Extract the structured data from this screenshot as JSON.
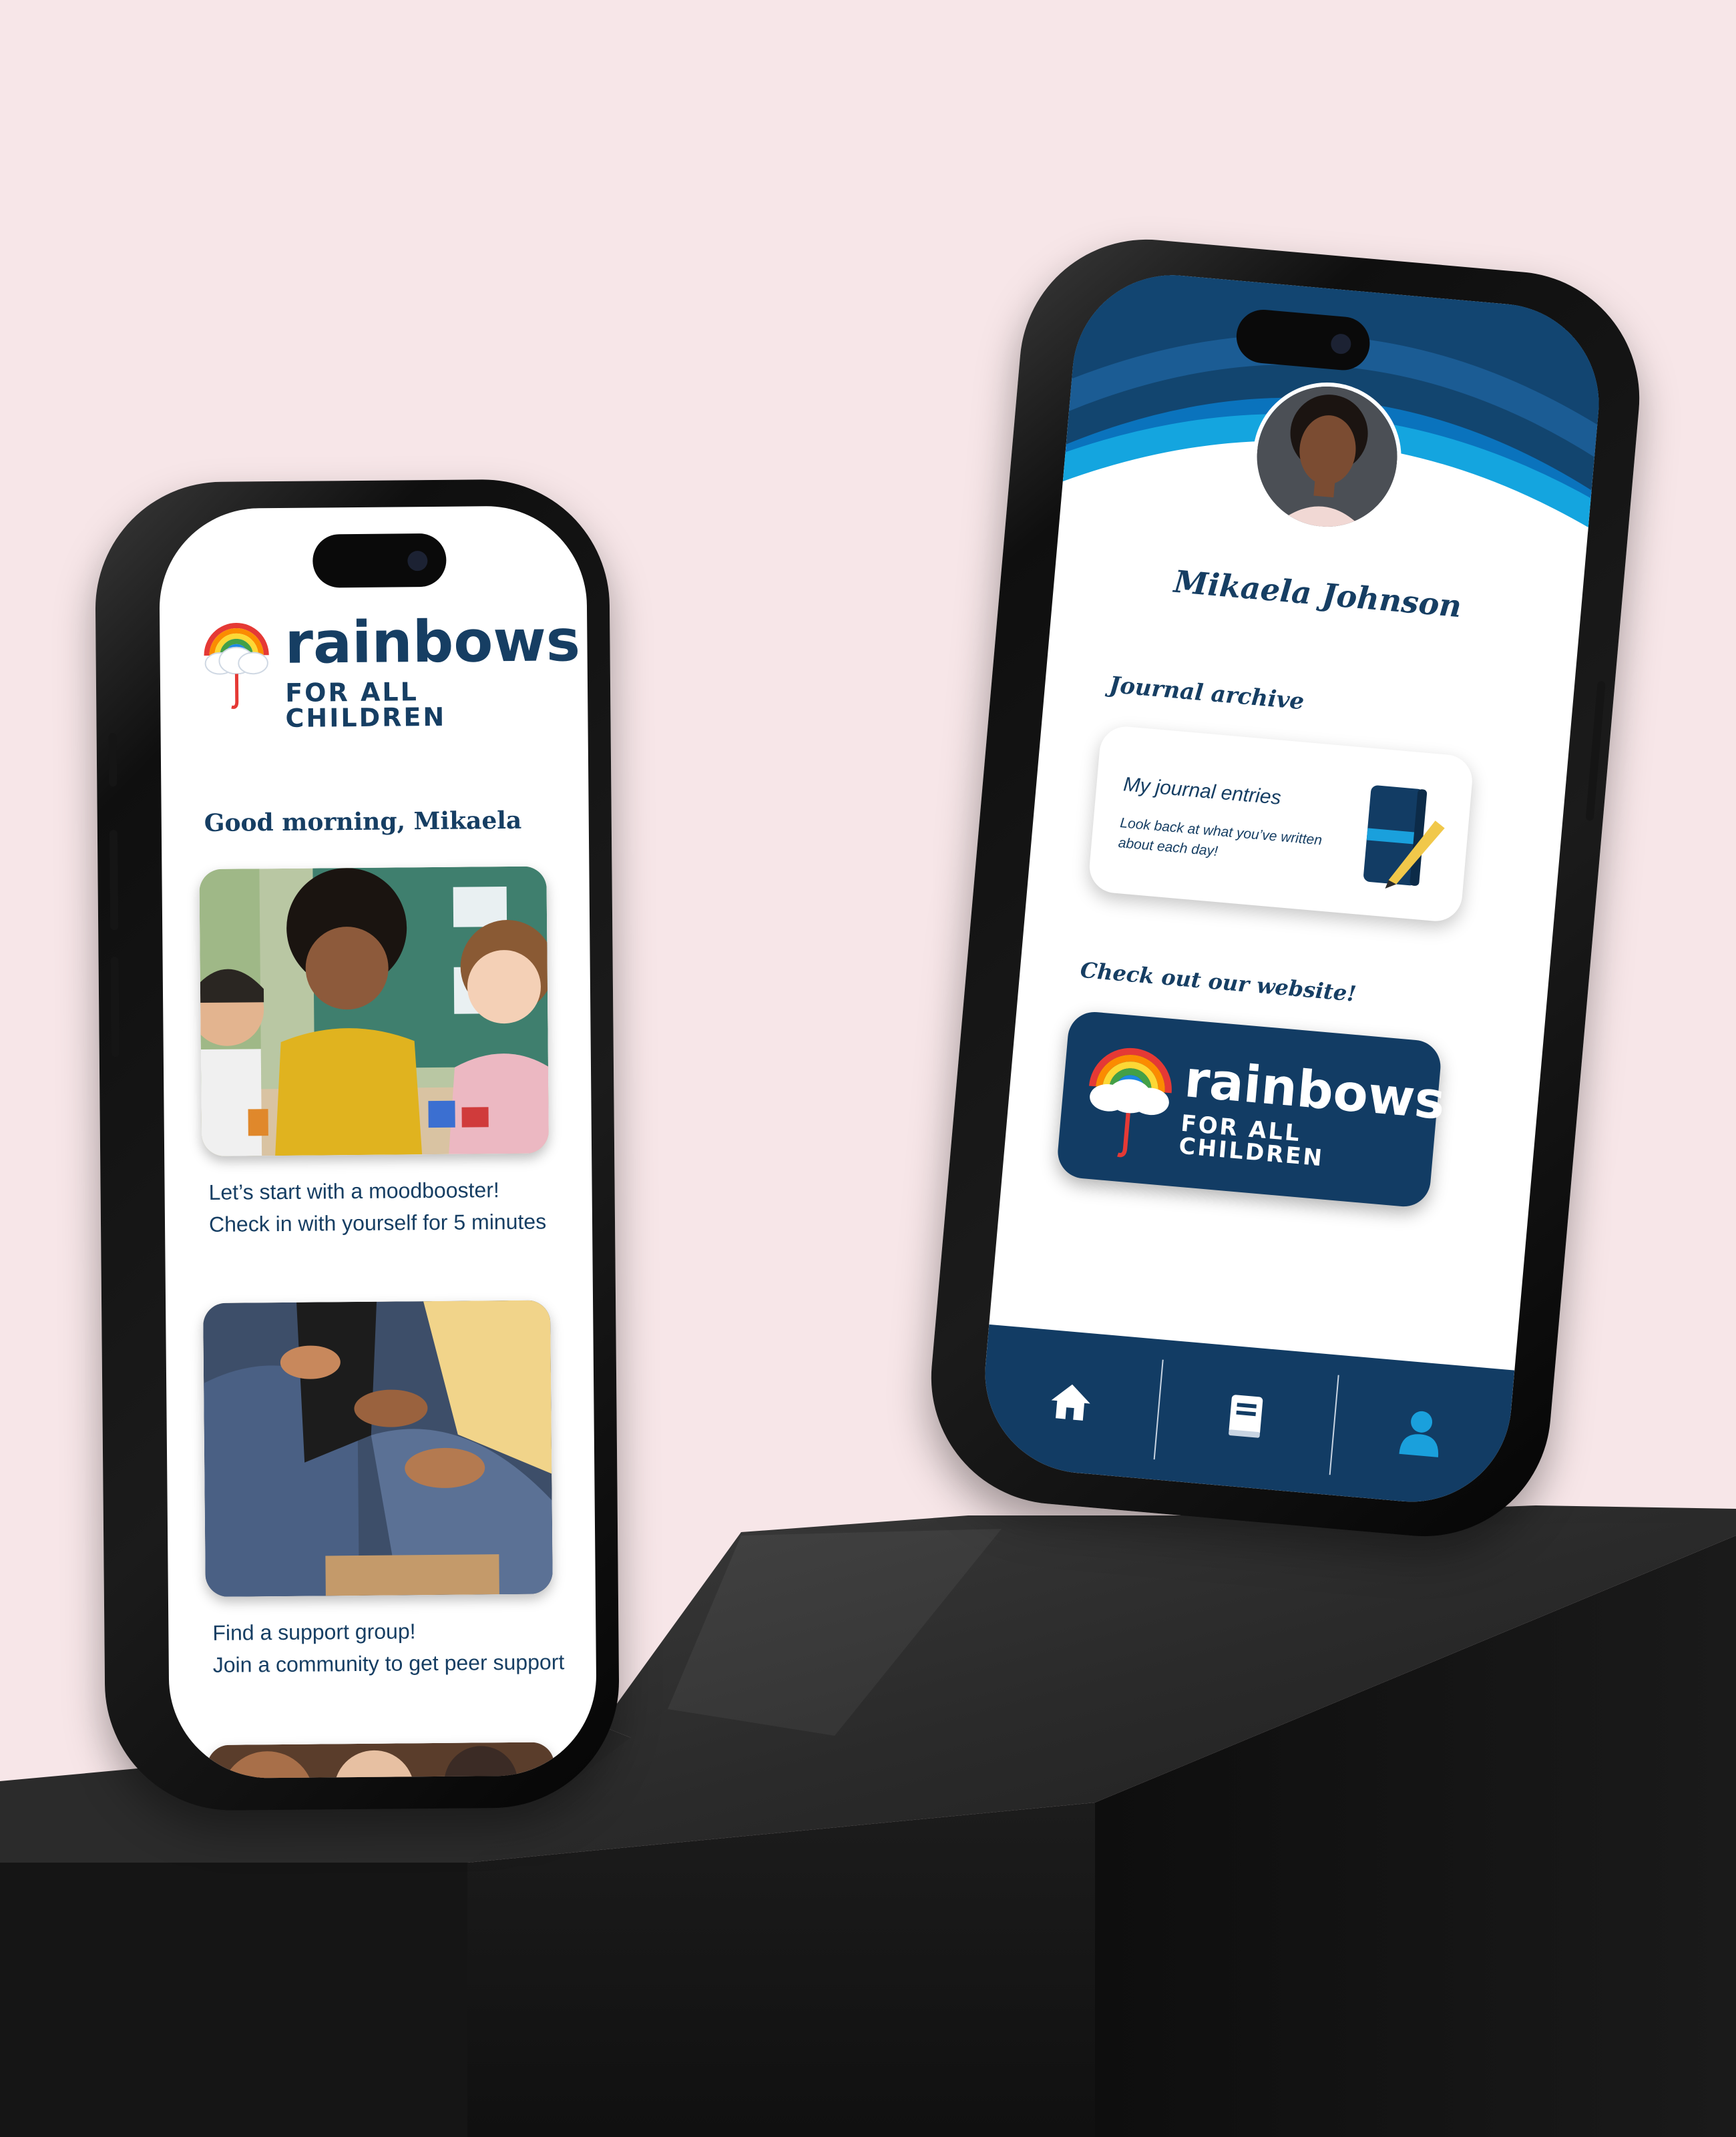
{
  "colors": {
    "background": "#f7e6e8",
    "navy": "#163e63",
    "accent_blue": "#1aa0dc",
    "pedestal": "#1e1e1e"
  },
  "brand": {
    "word": "rainbows",
    "sub": "FOR ALL CHILDREN"
  },
  "home_screen": {
    "greeting": "Good morning, Mikaela",
    "cards": [
      {
        "line1": "Let’s start with a moodbooster!",
        "line2": "Check in with yourself for 5 minutes"
      },
      {
        "line1": "Find a support group!",
        "line2": "Join a community to get peer support"
      }
    ]
  },
  "profile_screen": {
    "name": "Mikaela Johnson",
    "journal_section": "Journal archive",
    "journal_title": "My journal entries",
    "journal_desc_1": "Look back at what you’ve written",
    "journal_desc_2": "about each day!",
    "website_section": "Check out our website!",
    "tabs": [
      {
        "icon": "home-icon",
        "active": false
      },
      {
        "icon": "journal-icon",
        "active": false
      },
      {
        "icon": "profile-icon",
        "active": true
      }
    ]
  }
}
